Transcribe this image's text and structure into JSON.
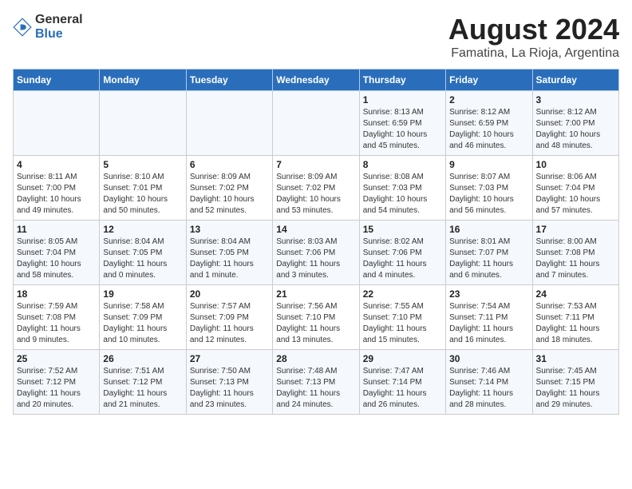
{
  "logo": {
    "general": "General",
    "blue": "Blue"
  },
  "title": "August 2024",
  "subtitle": "Famatina, La Rioja, Argentina",
  "days_of_week": [
    "Sunday",
    "Monday",
    "Tuesday",
    "Wednesday",
    "Thursday",
    "Friday",
    "Saturday"
  ],
  "weeks": [
    [
      {
        "day": "",
        "content": ""
      },
      {
        "day": "",
        "content": ""
      },
      {
        "day": "",
        "content": ""
      },
      {
        "day": "",
        "content": ""
      },
      {
        "day": "1",
        "content": "Sunrise: 8:13 AM\nSunset: 6:59 PM\nDaylight: 10 hours\nand 45 minutes."
      },
      {
        "day": "2",
        "content": "Sunrise: 8:12 AM\nSunset: 6:59 PM\nDaylight: 10 hours\nand 46 minutes."
      },
      {
        "day": "3",
        "content": "Sunrise: 8:12 AM\nSunset: 7:00 PM\nDaylight: 10 hours\nand 48 minutes."
      }
    ],
    [
      {
        "day": "4",
        "content": "Sunrise: 8:11 AM\nSunset: 7:00 PM\nDaylight: 10 hours\nand 49 minutes."
      },
      {
        "day": "5",
        "content": "Sunrise: 8:10 AM\nSunset: 7:01 PM\nDaylight: 10 hours\nand 50 minutes."
      },
      {
        "day": "6",
        "content": "Sunrise: 8:09 AM\nSunset: 7:02 PM\nDaylight: 10 hours\nand 52 minutes."
      },
      {
        "day": "7",
        "content": "Sunrise: 8:09 AM\nSunset: 7:02 PM\nDaylight: 10 hours\nand 53 minutes."
      },
      {
        "day": "8",
        "content": "Sunrise: 8:08 AM\nSunset: 7:03 PM\nDaylight: 10 hours\nand 54 minutes."
      },
      {
        "day": "9",
        "content": "Sunrise: 8:07 AM\nSunset: 7:03 PM\nDaylight: 10 hours\nand 56 minutes."
      },
      {
        "day": "10",
        "content": "Sunrise: 8:06 AM\nSunset: 7:04 PM\nDaylight: 10 hours\nand 57 minutes."
      }
    ],
    [
      {
        "day": "11",
        "content": "Sunrise: 8:05 AM\nSunset: 7:04 PM\nDaylight: 10 hours\nand 58 minutes."
      },
      {
        "day": "12",
        "content": "Sunrise: 8:04 AM\nSunset: 7:05 PM\nDaylight: 11 hours\nand 0 minutes."
      },
      {
        "day": "13",
        "content": "Sunrise: 8:04 AM\nSunset: 7:05 PM\nDaylight: 11 hours\nand 1 minute."
      },
      {
        "day": "14",
        "content": "Sunrise: 8:03 AM\nSunset: 7:06 PM\nDaylight: 11 hours\nand 3 minutes."
      },
      {
        "day": "15",
        "content": "Sunrise: 8:02 AM\nSunset: 7:06 PM\nDaylight: 11 hours\nand 4 minutes."
      },
      {
        "day": "16",
        "content": "Sunrise: 8:01 AM\nSunset: 7:07 PM\nDaylight: 11 hours\nand 6 minutes."
      },
      {
        "day": "17",
        "content": "Sunrise: 8:00 AM\nSunset: 7:08 PM\nDaylight: 11 hours\nand 7 minutes."
      }
    ],
    [
      {
        "day": "18",
        "content": "Sunrise: 7:59 AM\nSunset: 7:08 PM\nDaylight: 11 hours\nand 9 minutes."
      },
      {
        "day": "19",
        "content": "Sunrise: 7:58 AM\nSunset: 7:09 PM\nDaylight: 11 hours\nand 10 minutes."
      },
      {
        "day": "20",
        "content": "Sunrise: 7:57 AM\nSunset: 7:09 PM\nDaylight: 11 hours\nand 12 minutes."
      },
      {
        "day": "21",
        "content": "Sunrise: 7:56 AM\nSunset: 7:10 PM\nDaylight: 11 hours\nand 13 minutes."
      },
      {
        "day": "22",
        "content": "Sunrise: 7:55 AM\nSunset: 7:10 PM\nDaylight: 11 hours\nand 15 minutes."
      },
      {
        "day": "23",
        "content": "Sunrise: 7:54 AM\nSunset: 7:11 PM\nDaylight: 11 hours\nand 16 minutes."
      },
      {
        "day": "24",
        "content": "Sunrise: 7:53 AM\nSunset: 7:11 PM\nDaylight: 11 hours\nand 18 minutes."
      }
    ],
    [
      {
        "day": "25",
        "content": "Sunrise: 7:52 AM\nSunset: 7:12 PM\nDaylight: 11 hours\nand 20 minutes."
      },
      {
        "day": "26",
        "content": "Sunrise: 7:51 AM\nSunset: 7:12 PM\nDaylight: 11 hours\nand 21 minutes."
      },
      {
        "day": "27",
        "content": "Sunrise: 7:50 AM\nSunset: 7:13 PM\nDaylight: 11 hours\nand 23 minutes."
      },
      {
        "day": "28",
        "content": "Sunrise: 7:48 AM\nSunset: 7:13 PM\nDaylight: 11 hours\nand 24 minutes."
      },
      {
        "day": "29",
        "content": "Sunrise: 7:47 AM\nSunset: 7:14 PM\nDaylight: 11 hours\nand 26 minutes."
      },
      {
        "day": "30",
        "content": "Sunrise: 7:46 AM\nSunset: 7:14 PM\nDaylight: 11 hours\nand 28 minutes."
      },
      {
        "day": "31",
        "content": "Sunrise: 7:45 AM\nSunset: 7:15 PM\nDaylight: 11 hours\nand 29 minutes."
      }
    ]
  ]
}
